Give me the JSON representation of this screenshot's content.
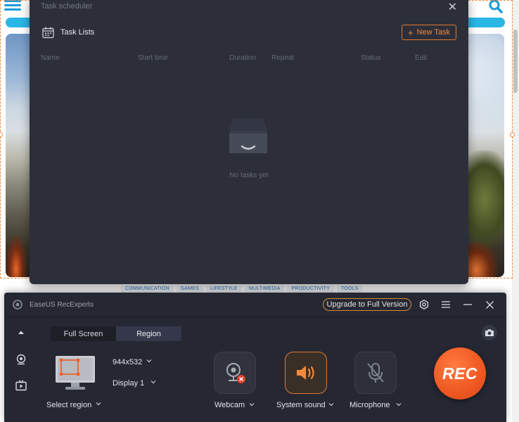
{
  "background_page": {
    "categories": [
      "COMMUNICATION",
      "GAMES",
      "LIFESTYLE",
      "MULTIMEDIA",
      "PRODUCTIVITY",
      "TOOLS"
    ]
  },
  "scheduler": {
    "title": "Task scheduler",
    "section_title": "Task Lists",
    "new_task_label": "New Task",
    "columns": [
      "Name",
      "Start time",
      "Duration",
      "Repeat",
      "Status",
      "Edit"
    ],
    "empty_text": "No tasks yet"
  },
  "recorder": {
    "app_name": "EaseUS RecExperts",
    "upgrade_label": "Upgrade to Full Version",
    "tabs": [
      {
        "label": "Full Screen",
        "active": false
      },
      {
        "label": "Region",
        "active": true
      }
    ],
    "resolution": "944x532",
    "display": "Display 1",
    "select_region_label": "Select region",
    "webcam_label": "Webcam",
    "system_sound_label": "System sound",
    "microphone_label": "Microphone",
    "rec_label": "REC"
  },
  "colors": {
    "accent": "#f05a22",
    "panel_bg": "#252833",
    "dialog_bg": "#2c2f3a",
    "selection_border": "#f08a3c",
    "site_accent": "#29b7e6"
  }
}
